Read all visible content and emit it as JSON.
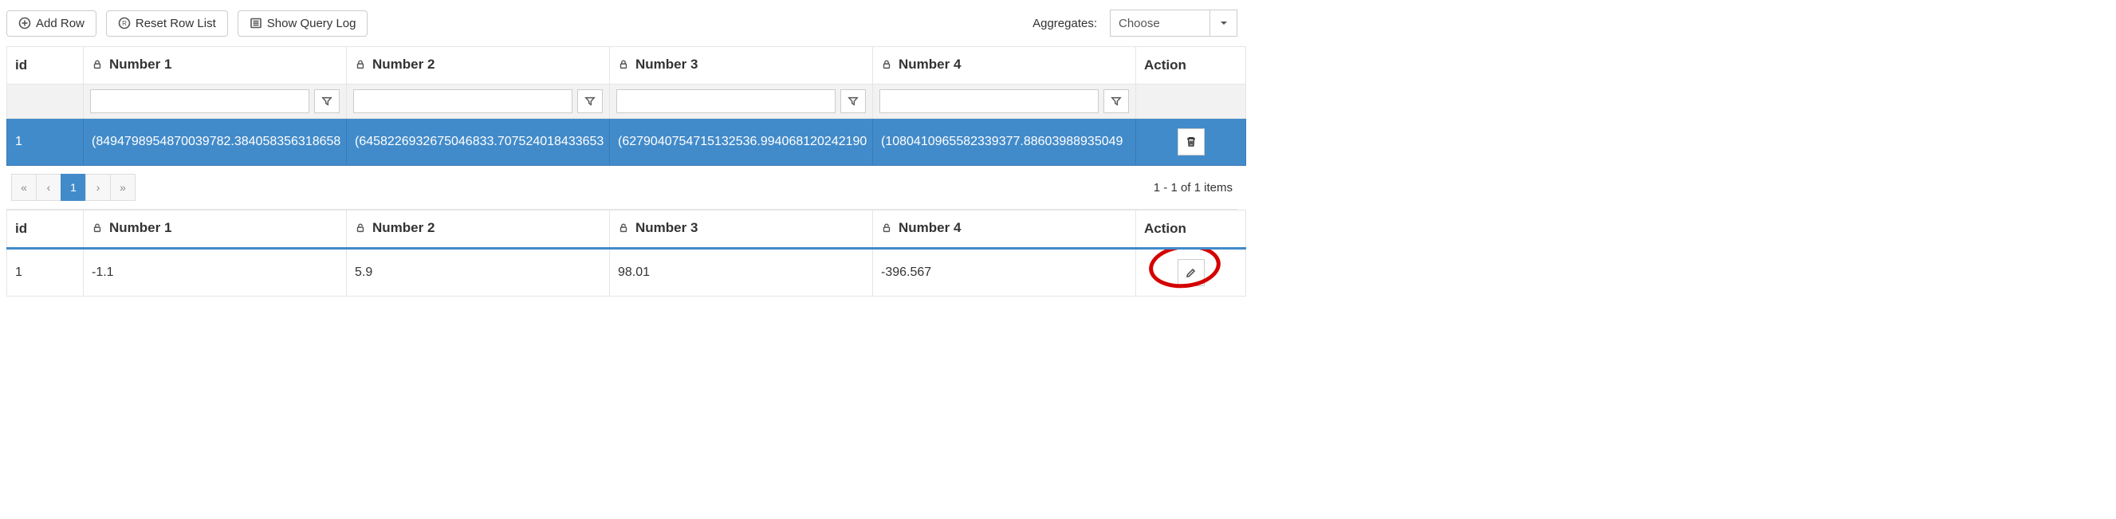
{
  "toolbar": {
    "add_row": "Add Row",
    "reset_row_list": "Reset Row List",
    "show_query_log": "Show Query Log",
    "aggregates_label": "Aggregates:",
    "aggregates_value": "Choose"
  },
  "grid1": {
    "headers": {
      "id": "id",
      "number1": "Number 1",
      "number2": "Number 2",
      "number3": "Number 3",
      "number4": "Number 4",
      "action": "Action"
    },
    "row": {
      "id": "1",
      "number1": "(8494798954870039782.384058356318658",
      "number2": "(6458226932675046833.707524018433653",
      "number3": "(6279040754715132536.994068120242190",
      "number4": "(1080410965582339377.88603988935049"
    }
  },
  "pager": {
    "first": "«",
    "prev": "‹",
    "page": "1",
    "next": "›",
    "last": "»",
    "info": "1 - 1 of 1 items"
  },
  "grid2": {
    "headers": {
      "id": "id",
      "number1": "Number 1",
      "number2": "Number 2",
      "number3": "Number 3",
      "number4": "Number 4",
      "action": "Action"
    },
    "row": {
      "id": "1",
      "number1": "-1.1",
      "number2": "5.9",
      "number3": "98.01",
      "number4": "-396.567"
    }
  }
}
